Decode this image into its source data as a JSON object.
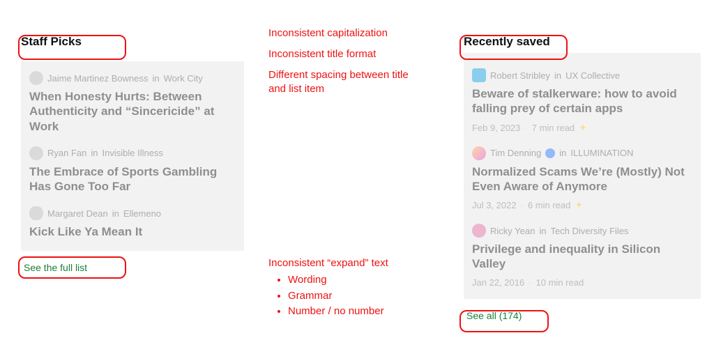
{
  "left": {
    "title": "Staff Picks",
    "items": [
      {
        "author": "Jaime Martinez Bowness",
        "in": "in",
        "pub": "Work City",
        "title": "When Honesty Hurts: Between Authenticity and “Sincericide” at Work"
      },
      {
        "author": "Ryan Fan",
        "in": "in",
        "pub": "Invisible Illness",
        "title": "The Embrace of Sports Gambling Has Gone Too Far"
      },
      {
        "author": "Margaret Dean",
        "in": "in",
        "pub": "Ellemeno",
        "title": "Kick Like Ya Mean It"
      }
    ],
    "expand": "See the full list"
  },
  "right": {
    "title": "Recently saved",
    "items": [
      {
        "author": "Robert Stribley",
        "in": "in",
        "pub": "UX Collective",
        "title": "Beware of stalkerware: how to avoid falling prey of certain apps",
        "date": "Feb 9, 2023",
        "read": "7 min read",
        "star": "✦"
      },
      {
        "author": "Tim Denning",
        "in": "in",
        "pub": "ILLUMINATION",
        "title": "Normalized Scams We’re (Mostly) Not Even Aware of Anymore",
        "date": "Jul 3, 2022",
        "read": "6 min read",
        "star": "✦"
      },
      {
        "author": "Ricky Yean",
        "in": "in",
        "pub": "Tech Diversity Files",
        "title": "Privilege and inequality in Silicon Valley",
        "date": "Jan 22, 2016",
        "read": "10 min read"
      }
    ],
    "expand": "See all (174)"
  },
  "annotations": {
    "a1": "Inconsistent capitalization",
    "a2": "Inconsistent title format",
    "a3": "Different spacing between title and list item",
    "a4": "Inconsistent “expand” text",
    "b1": "Wording",
    "b2": "Grammar",
    "b3": "Number / no number"
  }
}
